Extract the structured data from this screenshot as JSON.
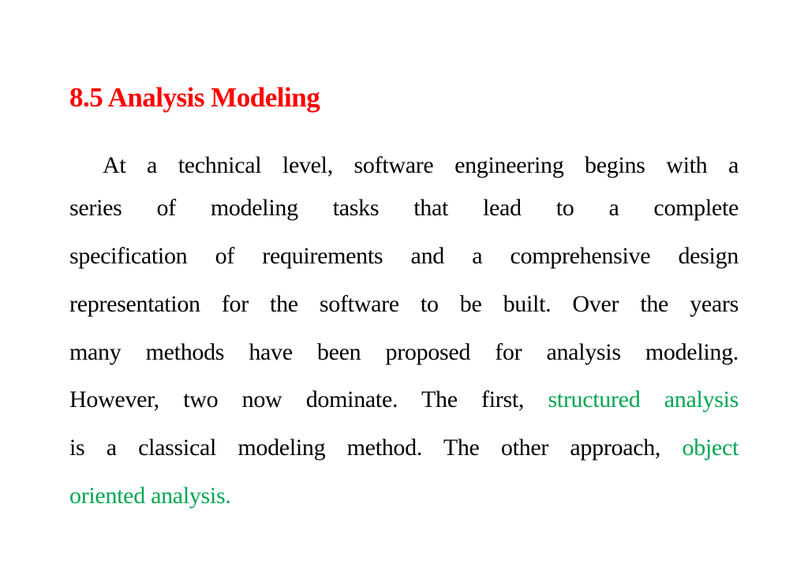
{
  "slide": {
    "title": "8.5 Analysis Modeling",
    "accent_colors": {
      "title": "#ff0000",
      "highlight": "#00a650"
    },
    "lines": [
      {
        "text": "At a technical level, software engineering begins with a"
      },
      {
        "text": "series of modeling tasks that lead to a complete"
      },
      {
        "text": "specification  of requirements and a comprehensive design"
      },
      {
        "text": "representation  for the software to be built. Over the years"
      },
      {
        "text": "many methods  have been proposed for analysis modeling."
      },
      {
        "text": "However, two  now dominate. The first,",
        "highlight": "structured analysis"
      },
      {
        "text": "is a classical  modeling method. The other approach,",
        "highlight": "object"
      },
      {
        "highlight": "oriented  analysis."
      }
    ]
  }
}
